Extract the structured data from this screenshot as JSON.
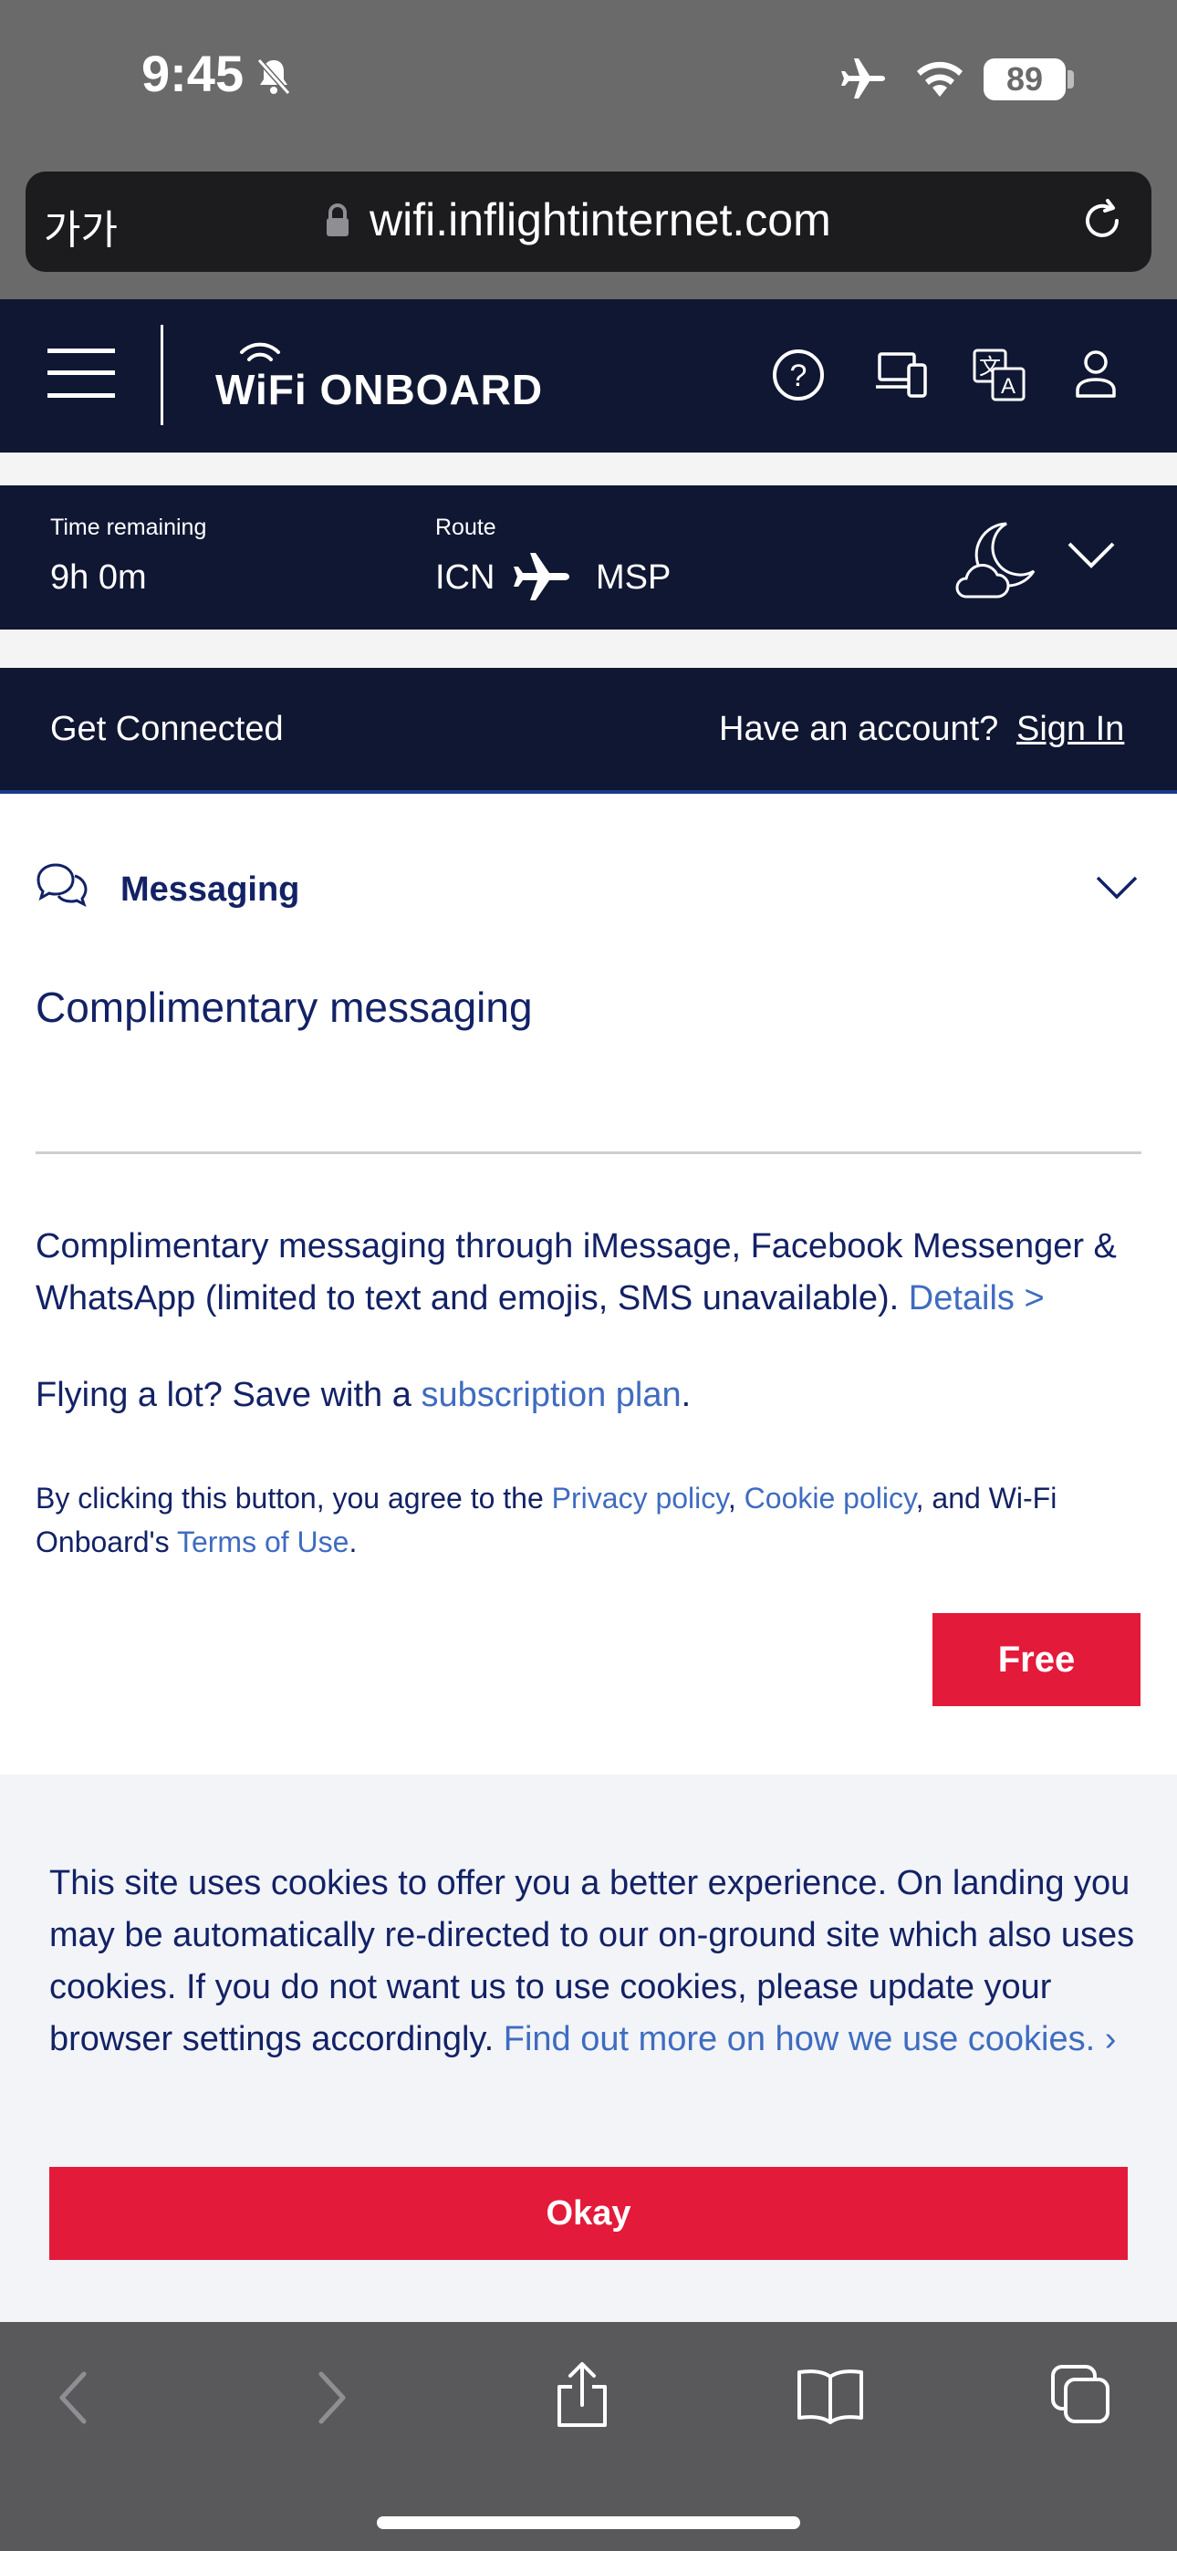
{
  "status_bar": {
    "time": "9:45",
    "battery": "89"
  },
  "browser": {
    "text_size_label": "가가",
    "url": "wifi.inflightinternet.com"
  },
  "header": {
    "logo_text": "WiFi ONBOARD"
  },
  "flight": {
    "time_remaining_label": "Time remaining",
    "time_remaining_value": "9h 0m",
    "route_label": "Route",
    "origin": "ICN",
    "destination": "MSP"
  },
  "connect_bar": {
    "title": "Get Connected",
    "account_prompt": "Have an account?",
    "sign_in": "Sign In"
  },
  "plan": {
    "section_title": "Messaging",
    "plan_title": "Complimentary messaging",
    "description": "Complimentary messaging through iMessage, Facebook Messenger & WhatsApp (limited to text and emojis, SMS unavailable).",
    "details_link": "Details >",
    "save_prefix": "Flying a lot? Save with a",
    "subscription_link": "subscription plan",
    "save_suffix": ".",
    "terms_prefix": "By clicking this button, you agree to the",
    "privacy_link": "Privacy policy",
    "comma": ",",
    "cookie_link": "Cookie policy",
    "terms_middle": ", and Wi-Fi Onboard's",
    "terms_link": "Terms of Use",
    "terms_suffix": ".",
    "free_button": "Free"
  },
  "cookie_banner": {
    "text": "This site uses cookies to offer you a better experience. On landing you may be automatically re-directed to our on-ground site which also uses cookies. If you do not want us to use cookies, please update your browser settings accordingly.",
    "link": "Find out more on how we use cookies. ›",
    "okay_button": "Okay"
  },
  "colors": {
    "navy": "#101733",
    "text_navy": "#132266",
    "link_blue": "#3f6cc0",
    "accent_red": "#e41a3a"
  },
  "icons": [
    "bell-slash-icon",
    "airplane-icon",
    "wifi-icon",
    "lock-icon",
    "reload-icon",
    "menu-icon",
    "help-icon",
    "devices-icon",
    "language-icon",
    "user-icon",
    "plane-icon",
    "moon-cloud-icon",
    "chevron-down-icon",
    "chat-icon",
    "back-icon",
    "forward-icon",
    "share-icon",
    "bookmarks-icon",
    "tabs-icon"
  ]
}
